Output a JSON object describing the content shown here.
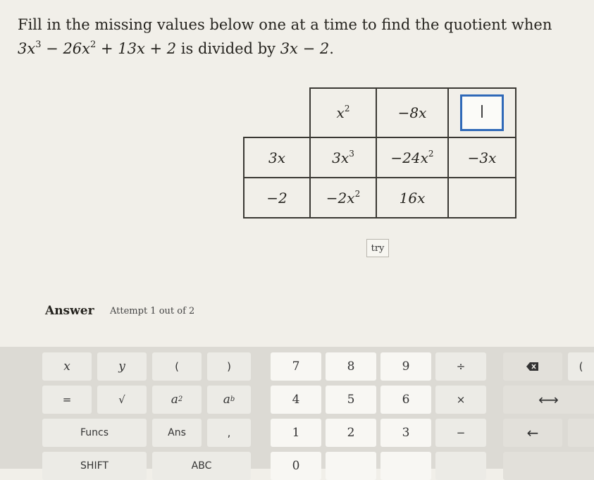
{
  "question": {
    "line1": "Fill in the missing values below one at a time to find the quotient when",
    "dividend": {
      "t1": "3x",
      "e1": "3",
      "t2": " − 26x",
      "e2": "2",
      "t3": " + 13x + 2"
    },
    "middle": " is divided by ",
    "divisor": "3x − 2",
    "end": "."
  },
  "grid": {
    "header": [
      {
        "base": "x",
        "exp": "2"
      },
      {
        "base": "−8x",
        "exp": ""
      }
    ],
    "rows": [
      {
        "label": "3x",
        "cells": [
          {
            "base": "3x",
            "exp": "3"
          },
          {
            "base": "−24x",
            "exp": "2"
          },
          {
            "base": "−3x",
            "exp": ""
          }
        ]
      },
      {
        "label": "−2",
        "cells": [
          {
            "base": "−2x",
            "exp": "2"
          },
          {
            "base": "16x",
            "exp": ""
          },
          {
            "base": "",
            "exp": ""
          }
        ]
      }
    ]
  },
  "try_label": "try",
  "answer": {
    "label": "Answer",
    "attempt": "Attempt 1 out of 2"
  },
  "keypad": {
    "row1": {
      "x": "x",
      "y": "y",
      "lparen": "(",
      "rparen": ")",
      "k7": "7",
      "k8": "8",
      "k9": "9",
      "div": "÷",
      "lparen2": "("
    },
    "row2": {
      "eq": "=",
      "sqrt": "√",
      "a2_base": "a",
      "a2_exp": "2",
      "ab_base": "a",
      "ab_exp": "b",
      "k4": "4",
      "k5": "5",
      "k6": "6",
      "mul": "×",
      "arrows": "⟷"
    },
    "row3": {
      "funcs": "Funcs",
      "ans": "Ans",
      "comma": ",",
      "k1": "1",
      "k2": "2",
      "k3": "3",
      "minus": "−",
      "left": "←"
    },
    "row4": {
      "shift": "SHIFT",
      "abc": "ABC",
      "k0": "0"
    }
  }
}
